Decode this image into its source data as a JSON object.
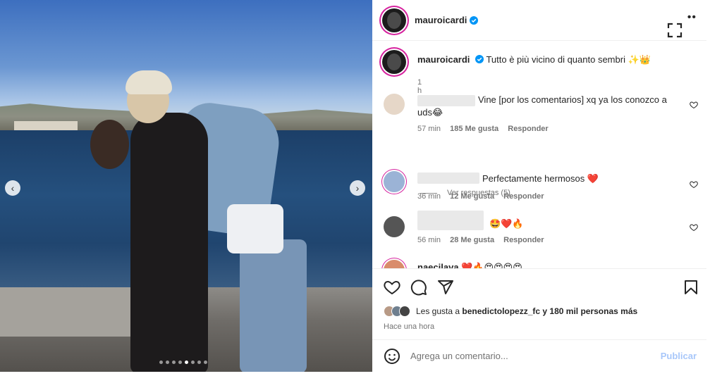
{
  "post": {
    "username": "mauroicardi",
    "caption": "Tutto è più vicino di quanto sembri",
    "caption_emoji": "✨👑",
    "caption_time": "1 h",
    "carousel_dots": 8,
    "carousel_active_dot": 4
  },
  "comments": [
    {
      "text": "Vine [por los comentarios] xq ya los conozco a uds😂",
      "time": "57 min",
      "likes": "185 Me gusta",
      "reply": "Responder",
      "view_replies": "Ver respuestas (5)"
    },
    {
      "text": "Perfectamente hermosos ❤️",
      "time": "36 min",
      "likes": "12 Me gusta",
      "reply": "Responder"
    },
    {
      "text": "🤩❤️🔥",
      "time": "56 min",
      "likes": "28 Me gusta",
      "reply": "Responder"
    },
    {
      "text_partial": "naecilava",
      "emoji": "❤️🔥😍😍😍😍"
    }
  ],
  "likes_bar": {
    "prefix": "Les gusta a",
    "user": "benedictolopezz_fc",
    "suffix": "y 180 mil personas más",
    "when": "Hace una hora"
  },
  "composer": {
    "placeholder": "Agrega un comentario...",
    "post_label": "Publicar"
  },
  "colors": {
    "verified": "#0095f6",
    "publish_disabled": "#a8c7fa",
    "story_ring": "#d6249f",
    "heart_red": "#ed4956"
  }
}
